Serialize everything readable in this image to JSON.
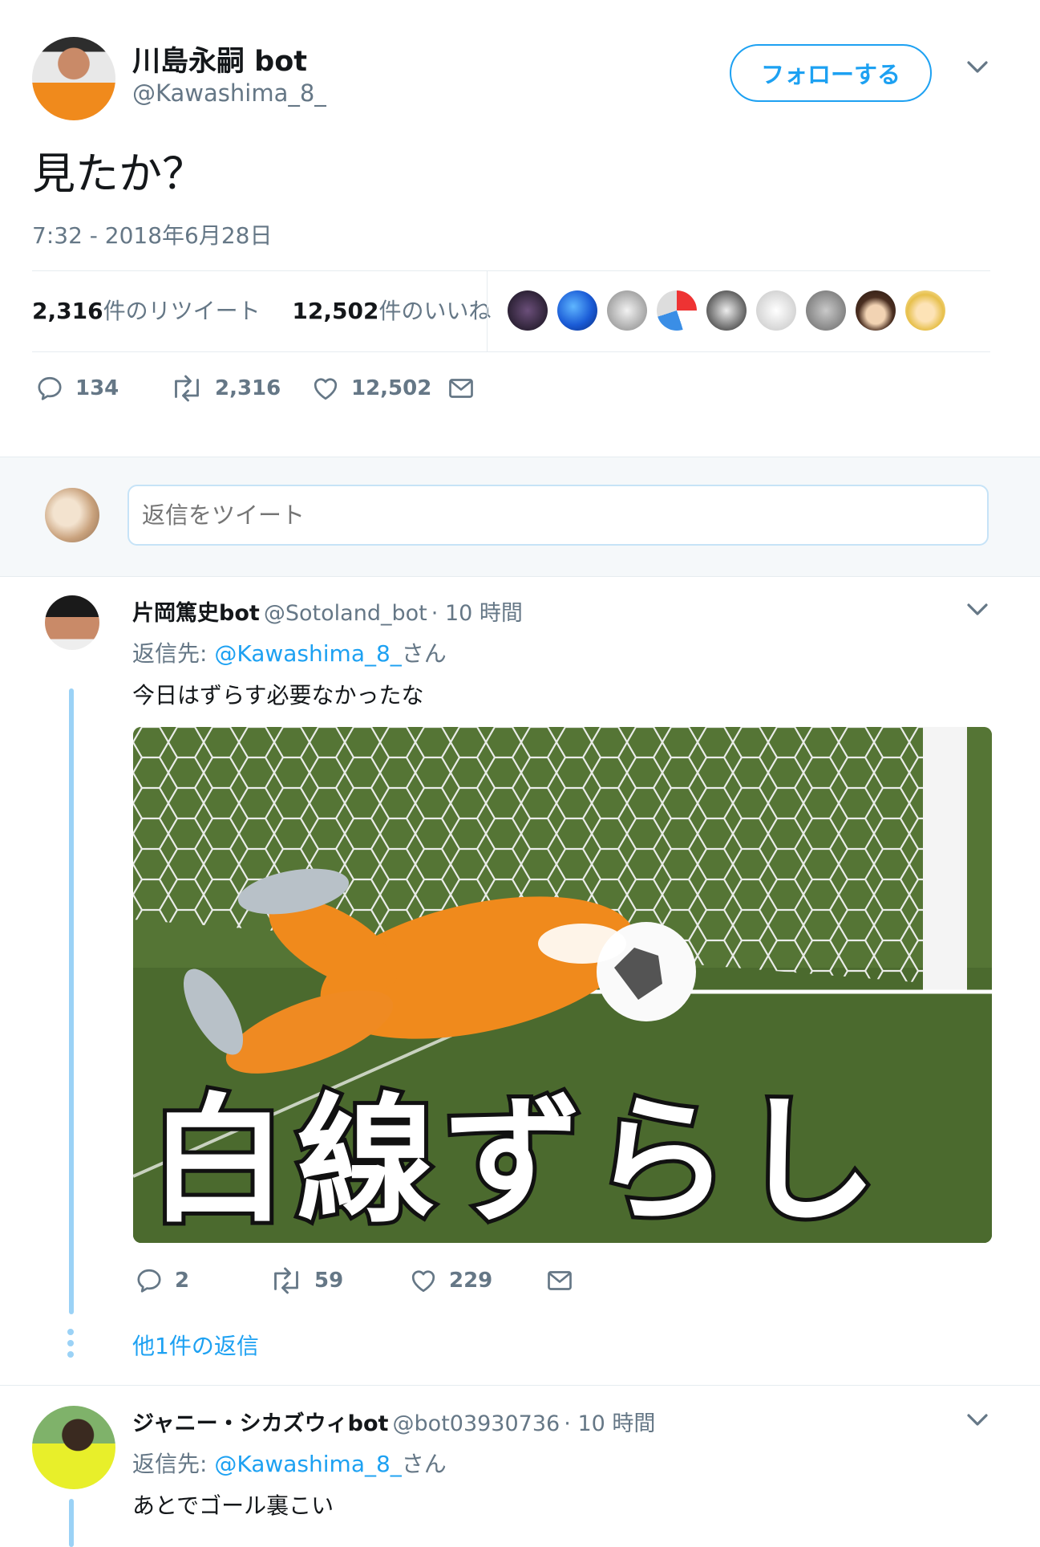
{
  "tweet": {
    "display_name": "川島永嗣 bot",
    "handle": "@Kawashima_8_",
    "follow_label": "フォローする",
    "text": "見たか？",
    "timestamp": "7:32 - 2018年6月28日",
    "retweet_count_bold": "2,316",
    "retweet_suffix": "件のリツイート",
    "like_count_bold": "12,502",
    "like_suffix": "件のいいね",
    "reply_count": "134",
    "retweets": "2,316",
    "likes": "12,502"
  },
  "composer": {
    "placeholder": "返信をツイート"
  },
  "replies": [
    {
      "name": "片岡篤史bot",
      "handle": "@Sotoland_bot",
      "time": "· 10 時間",
      "reply_to_prefix": "返信先: ",
      "reply_to_handle": "@Kawashima_8_",
      "reply_to_suffix": "さん",
      "text": "今日はずらす必要なかったな",
      "media_caption": "白線ずらし",
      "reply_count": "2",
      "retweets": "59",
      "likes": "229",
      "more_replies": "他1件の返信"
    },
    {
      "name": "ジャニー・シカズウィbot",
      "handle": "@bot03930736",
      "time": "· 10 時間",
      "reply_to_prefix": "返信先: ",
      "reply_to_handle": "@Kawashima_8_",
      "reply_to_suffix": "さん",
      "text": "あとでゴール裏こい"
    }
  ],
  "colors": {
    "accent": "#1da1f2",
    "secondary_text": "#657786",
    "thread_line": "#9bd2f6"
  }
}
